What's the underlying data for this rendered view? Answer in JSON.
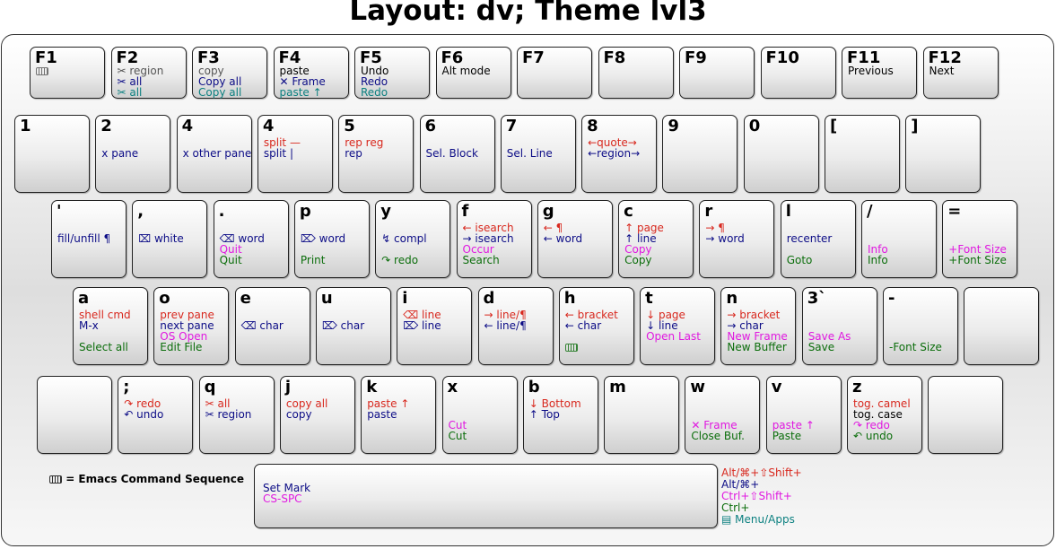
{
  "title": "Layout: dv; Theme lvl3",
  "colors": {
    "shift_alt": "#d8281e",
    "alt": "#0c0c86",
    "ctrl_shift": "#e018e0",
    "ctrl": "#0c6e0c",
    "menu": "#0c8080"
  },
  "legend": {
    "emacs_glyph": "keyboard-icon",
    "emacs_text": "= Emacs Command Sequence"
  },
  "modifiers": [
    {
      "text": "Alt/⌘+⇧Shift+",
      "color": "red"
    },
    {
      "text": "Alt/⌘+",
      "color": "navy"
    },
    {
      "text": "Ctrl+⇧Shift+",
      "color": "mag"
    },
    {
      "text": "Ctrl+",
      "color": "grn"
    },
    {
      "text": "▤ Menu/Apps",
      "color": "teal"
    }
  ],
  "rows": [
    {
      "type": "frow",
      "keys": [
        {
          "label": "F1",
          "lines": [
            {
              "t": "",
              "c": "gry",
              "icon": "keyboard-icon"
            }
          ]
        },
        {
          "label": "F2",
          "lines": [
            {
              "t": "✂ region",
              "c": "gry"
            },
            {
              "t": "✂ all",
              "c": "navy"
            },
            {
              "t": "✂ all",
              "c": "teal"
            }
          ]
        },
        {
          "label": "F3",
          "lines": [
            {
              "t": "copy",
              "c": "gry"
            },
            {
              "t": "Copy all",
              "c": "navy"
            },
            {
              "t": "Copy all",
              "c": "teal"
            }
          ]
        },
        {
          "label": "F4",
          "lines": [
            {
              "t": "paste",
              "c": "blk"
            },
            {
              "t": "✕ Frame",
              "c": "navy"
            },
            {
              "t": "paste ↑",
              "c": "teal"
            }
          ]
        },
        {
          "label": "F5",
          "lines": [
            {
              "t": "Undo",
              "c": "blk"
            },
            {
              "t": "Redo",
              "c": "navy"
            },
            {
              "t": "Redo",
              "c": "teal"
            }
          ]
        },
        {
          "label": "F6",
          "lines": [
            {
              "t": "Alt mode",
              "c": "blk"
            }
          ]
        },
        {
          "label": "F7",
          "lines": []
        },
        {
          "label": "F8",
          "lines": []
        },
        {
          "label": "F9",
          "lines": []
        },
        {
          "label": "F10",
          "lines": []
        },
        {
          "label": "F11",
          "lines": [
            {
              "t": "Previous",
              "c": "blk"
            }
          ]
        },
        {
          "label": "F12",
          "lines": [
            {
              "t": "Next",
              "c": "blk"
            }
          ]
        }
      ]
    },
    {
      "type": "row",
      "keys": [
        {
          "label": "1",
          "lines": []
        },
        {
          "label": "2",
          "lines": [
            {
              "t": "x pane",
              "c": "navy",
              "slot": 1
            }
          ]
        },
        {
          "label": "4",
          "lines": [
            {
              "t": "x other pane",
              "c": "navy",
              "slot": 1
            }
          ]
        },
        {
          "label": "4",
          "lines": [
            {
              "t": "split —",
              "c": "red",
              "slot": 0
            },
            {
              "t": "split |",
              "c": "navy",
              "slot": 1
            }
          ]
        },
        {
          "label": "5",
          "lines": [
            {
              "t": "rep reg",
              "c": "red",
              "slot": 0
            },
            {
              "t": "rep",
              "c": "navy",
              "slot": 1
            }
          ]
        },
        {
          "label": "6",
          "lines": [
            {
              "t": "Sel. Block",
              "c": "navy",
              "slot": 1
            }
          ]
        },
        {
          "label": "7",
          "lines": [
            {
              "t": "Sel. Line",
              "c": "navy",
              "slot": 1
            }
          ]
        },
        {
          "label": "8",
          "lines": [
            {
              "t": "←quote→",
              "c": "red",
              "slot": 0
            },
            {
              "t": "←region→",
              "c": "navy",
              "slot": 1
            }
          ]
        },
        {
          "label": "9",
          "lines": []
        },
        {
          "label": "0",
          "lines": []
        },
        {
          "label": "[",
          "lines": []
        },
        {
          "label": "]",
          "lines": []
        }
      ]
    },
    {
      "type": "row",
      "keys": [
        {
          "label": "'",
          "lines": [
            {
              "t": "fill/unfill ¶",
              "c": "navy",
              "slot": 1
            }
          ]
        },
        {
          "label": ",",
          "lines": [
            {
              "t": "⌧ white",
              "c": "navy",
              "slot": 1
            }
          ]
        },
        {
          "label": ".",
          "lines": [
            {
              "t": "⌫ word",
              "c": "navy",
              "slot": 1
            },
            {
              "t": "Quit",
              "c": "mag",
              "slot": 2
            },
            {
              "t": "Quit",
              "c": "grn",
              "slot": 3
            }
          ]
        },
        {
          "label": "p",
          "lines": [
            {
              "t": "⌦ word",
              "c": "navy",
              "slot": 1
            },
            {
              "t": "Print",
              "c": "grn",
              "slot": 3
            }
          ]
        },
        {
          "label": "y",
          "lines": [
            {
              "t": "↯ compl",
              "c": "navy",
              "slot": 1
            },
            {
              "t": "↷ redo",
              "c": "grn",
              "slot": 3
            }
          ]
        },
        {
          "label": "f",
          "lines": [
            {
              "t": "← isearch",
              "c": "red",
              "slot": 0
            },
            {
              "t": "→ isearch",
              "c": "navy",
              "slot": 1
            },
            {
              "t": "Occur",
              "c": "mag",
              "slot": 2
            },
            {
              "t": "Search",
              "c": "grn",
              "slot": 3
            }
          ]
        },
        {
          "label": "g",
          "lines": [
            {
              "t": "← ¶",
              "c": "red",
              "slot": 0
            },
            {
              "t": "← word",
              "c": "navy",
              "slot": 1
            }
          ]
        },
        {
          "label": "c",
          "lines": [
            {
              "t": "↑ page",
              "c": "red",
              "slot": 0
            },
            {
              "t": "↑ line",
              "c": "navy",
              "slot": 1
            },
            {
              "t": "Copy",
              "c": "mag",
              "slot": 2
            },
            {
              "t": "Copy",
              "c": "grn",
              "slot": 3
            }
          ]
        },
        {
          "label": "r",
          "lines": [
            {
              "t": "→ ¶",
              "c": "red",
              "slot": 0
            },
            {
              "t": "→ word",
              "c": "navy",
              "slot": 1
            }
          ]
        },
        {
          "label": "l",
          "lines": [
            {
              "t": "recenter",
              "c": "navy",
              "slot": 1
            },
            {
              "t": "Goto",
              "c": "grn",
              "slot": 3
            }
          ]
        },
        {
          "label": "/",
          "lines": [
            {
              "t": "Info",
              "c": "mag",
              "slot": 2
            },
            {
              "t": "Info",
              "c": "grn",
              "slot": 3
            }
          ]
        },
        {
          "label": "=",
          "lines": [
            {
              "t": "+Font Size",
              "c": "mag",
              "slot": 2
            },
            {
              "t": "+Font Size",
              "c": "grn",
              "slot": 3
            }
          ]
        }
      ]
    },
    {
      "type": "row",
      "keys": [
        {
          "label": "a",
          "lines": [
            {
              "t": "shell cmd",
              "c": "red",
              "slot": 0
            },
            {
              "t": "M-x",
              "c": "navy",
              "slot": 1
            },
            {
              "t": "Select all",
              "c": "grn",
              "slot": 3
            }
          ]
        },
        {
          "label": "o",
          "lines": [
            {
              "t": "prev pane",
              "c": "red",
              "slot": 0
            },
            {
              "t": "next pane",
              "c": "navy",
              "slot": 1
            },
            {
              "t": "OS Open",
              "c": "mag",
              "slot": 2
            },
            {
              "t": "Edit File",
              "c": "grn",
              "slot": 3
            }
          ]
        },
        {
          "label": "e",
          "lines": [
            {
              "t": "⌫ char",
              "c": "navy",
              "slot": 1
            }
          ]
        },
        {
          "label": "u",
          "lines": [
            {
              "t": "⌦ char",
              "c": "navy",
              "slot": 1
            }
          ]
        },
        {
          "label": "i",
          "lines": [
            {
              "t": "⌫ line",
              "c": "red",
              "slot": 0
            },
            {
              "t": "⌦ line",
              "c": "navy",
              "slot": 1
            }
          ]
        },
        {
          "label": "d",
          "lines": [
            {
              "t": "→ line/¶",
              "c": "red",
              "slot": 0
            },
            {
              "t": "← line/¶",
              "c": "navy",
              "slot": 1
            }
          ]
        },
        {
          "label": "h",
          "lines": [
            {
              "t": "← bracket",
              "c": "red",
              "slot": 0
            },
            {
              "t": "← char",
              "c": "navy",
              "slot": 1
            },
            {
              "t": "",
              "c": "grn",
              "slot": 3,
              "icon": "keyboard-icon"
            }
          ]
        },
        {
          "label": "t",
          "lines": [
            {
              "t": "↓ page",
              "c": "red",
              "slot": 0
            },
            {
              "t": "↓ line",
              "c": "navy",
              "slot": 1
            },
            {
              "t": "Open Last",
              "c": "mag",
              "slot": 2
            }
          ]
        },
        {
          "label": "n",
          "lines": [
            {
              "t": "→ bracket",
              "c": "red",
              "slot": 0
            },
            {
              "t": "→ char",
              "c": "navy",
              "slot": 1
            },
            {
              "t": "New Frame",
              "c": "mag",
              "slot": 2
            },
            {
              "t": "New Buffer",
              "c": "grn",
              "slot": 3
            }
          ]
        },
        {
          "label": "3`",
          "lines": [
            {
              "t": "Save As",
              "c": "mag",
              "slot": 2
            },
            {
              "t": "Save",
              "c": "grn",
              "slot": 3
            }
          ]
        },
        {
          "label": "-",
          "lines": [
            {
              "t": "-Font Size",
              "c": "grn",
              "slot": 3
            }
          ]
        },
        {
          "label": "",
          "lines": []
        }
      ]
    },
    {
      "type": "row",
      "keys": [
        {
          "label": "",
          "lines": []
        },
        {
          "label": ";",
          "lines": [
            {
              "t": "↷ redo",
              "c": "red",
              "slot": 0
            },
            {
              "t": "↶ undo",
              "c": "navy",
              "slot": 1
            }
          ]
        },
        {
          "label": "q",
          "lines": [
            {
              "t": "✂ all",
              "c": "red",
              "slot": 0
            },
            {
              "t": "✂ region",
              "c": "navy",
              "slot": 1
            }
          ]
        },
        {
          "label": "j",
          "lines": [
            {
              "t": "copy all",
              "c": "red",
              "slot": 0
            },
            {
              "t": "copy",
              "c": "navy",
              "slot": 1
            }
          ]
        },
        {
          "label": "k",
          "lines": [
            {
              "t": "paste ↑",
              "c": "red",
              "slot": 0
            },
            {
              "t": "paste",
              "c": "navy",
              "slot": 1
            }
          ]
        },
        {
          "label": "x",
          "lines": [
            {
              "t": "Cut",
              "c": "mag",
              "slot": 2
            },
            {
              "t": "Cut",
              "c": "grn",
              "slot": 3
            }
          ]
        },
        {
          "label": "b",
          "lines": [
            {
              "t": "↓ Bottom",
              "c": "red",
              "slot": 0
            },
            {
              "t": "↑ Top",
              "c": "navy",
              "slot": 1
            }
          ]
        },
        {
          "label": "m",
          "lines": []
        },
        {
          "label": "w",
          "lines": [
            {
              "t": "✕ Frame",
              "c": "mag",
              "slot": 2
            },
            {
              "t": "Close Buf.",
              "c": "grn",
              "slot": 3
            }
          ]
        },
        {
          "label": "v",
          "lines": [
            {
              "t": "paste ↑",
              "c": "mag",
              "slot": 2
            },
            {
              "t": "Paste",
              "c": "grn",
              "slot": 3
            }
          ]
        },
        {
          "label": "z",
          "lines": [
            {
              "t": "tog. camel",
              "c": "red",
              "slot": 0
            },
            {
              "t": "tog. case",
              "c": "blk",
              "slot": 1
            },
            {
              "t": "↷ redo",
              "c": "mag",
              "slot": 2
            },
            {
              "t": "↶ undo",
              "c": "grn",
              "slot": 3
            }
          ]
        },
        {
          "label": "",
          "lines": []
        }
      ]
    }
  ],
  "space": {
    "lines": [
      {
        "t": "Set Mark",
        "c": "navy"
      },
      {
        "t": "CS-SPC",
        "c": "mag"
      }
    ]
  }
}
